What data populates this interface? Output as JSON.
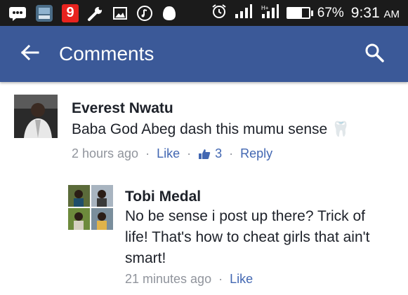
{
  "status_bar": {
    "notification_badge": "9",
    "battery_percent": "67%",
    "battery_level": 0.67,
    "time": "9:31",
    "am_pm": "AM"
  },
  "app_bar": {
    "title": "Comments",
    "color": "#3b5998"
  },
  "comments": [
    {
      "author": "Everest Nwatu",
      "text": "Baba God Abeg dash this mumu sense 🦷",
      "time": "2 hours ago",
      "like_label": "Like",
      "like_count": "3",
      "reply_label": "Reply"
    },
    {
      "author": "Tobi Medal",
      "text": "No be sense i post up there? Trick of life! That's how to cheat girls that ain't smart!",
      "time": "21 minutes ago",
      "like_label": "Like"
    }
  ],
  "separator": "·"
}
